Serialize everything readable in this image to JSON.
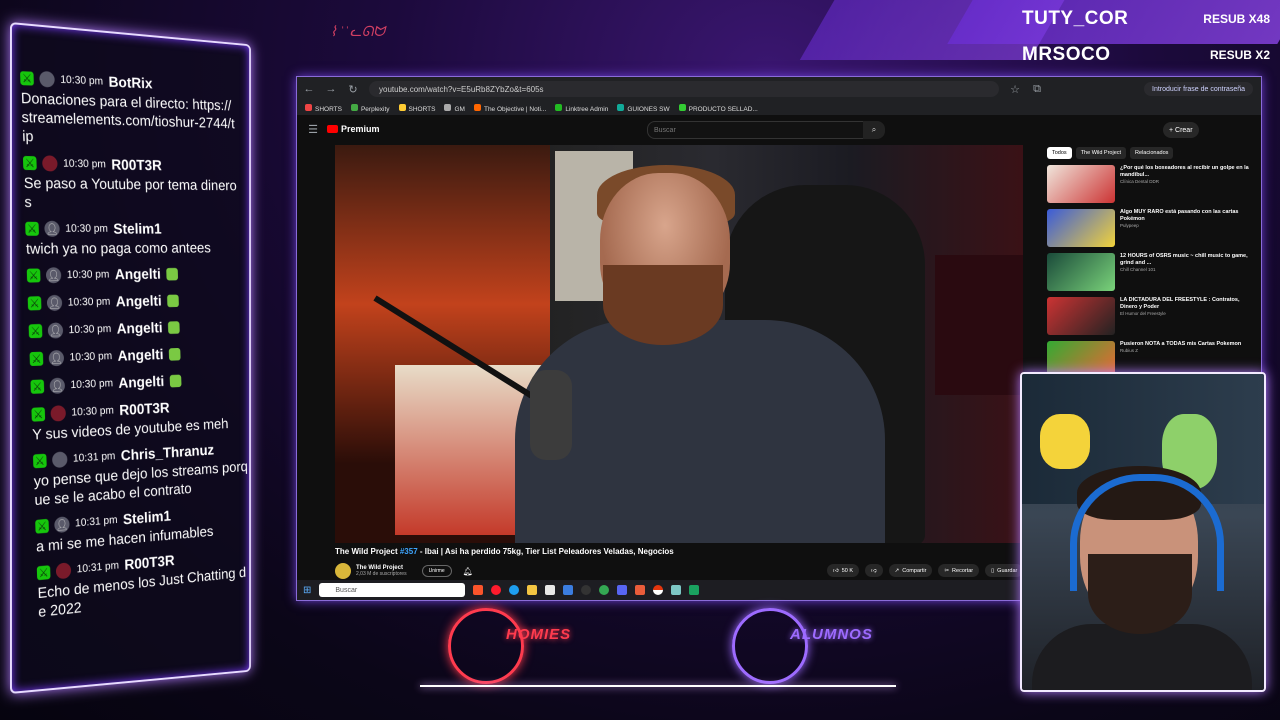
{
  "overlay": {
    "top_subs": [
      {
        "name": "TUTY_COR",
        "tag": "RESUB X48"
      },
      {
        "name": "MRSOCO",
        "tag": "RESUB X2"
      }
    ],
    "teams": [
      {
        "label": "HOMIES",
        "color": "#ff3b4e"
      },
      {
        "label": "ALUMNOS",
        "color": "#9d6bff"
      }
    ]
  },
  "chat": {
    "messages": [
      {
        "time": "10:30 pm",
        "user": "BotRix",
        "text": "Donaciones para el directo: https://streamelements.com/tioshur-2744/tip",
        "avatar": "bot"
      },
      {
        "time": "10:30 pm",
        "user": "R00T3R",
        "text": "Se paso a Youtube por tema dineros",
        "avatar": "red"
      },
      {
        "time": "10:30 pm",
        "user": "Stelim1",
        "text": "twich ya no paga como antees",
        "avatar": "default"
      },
      {
        "time": "10:30 pm",
        "user": "Angelti",
        "text": "",
        "avatar": "default",
        "emote": true
      },
      {
        "time": "10:30 pm",
        "user": "Angelti",
        "text": "",
        "avatar": "default",
        "emote": true
      },
      {
        "time": "10:30 pm",
        "user": "Angelti",
        "text": "",
        "avatar": "default",
        "emote": true
      },
      {
        "time": "10:30 pm",
        "user": "Angelti",
        "text": "",
        "avatar": "default",
        "emote": true
      },
      {
        "time": "10:30 pm",
        "user": "Angelti",
        "text": "",
        "avatar": "default",
        "emote": true
      },
      {
        "time": "10:30 pm",
        "user": "R00T3R",
        "text": "Y sus videos de youtube es meh",
        "avatar": "red"
      },
      {
        "time": "10:31 pm",
        "user": "Chris_Thranuz",
        "text": "yo pense que dejo los streams porque se le acabo el contrato",
        "avatar": "photo"
      },
      {
        "time": "10:31 pm",
        "user": "Stelim1",
        "text": "a mi se me hacen infumables",
        "avatar": "default"
      },
      {
        "time": "10:31 pm",
        "user": "R00T3R",
        "text": "Echo de menos los Just Chatting de 2022",
        "avatar": "red"
      }
    ]
  },
  "browser": {
    "url": "youtube.com/watch?v=E5uRb8ZYbZo&t=605s",
    "password_prompt": "Introducir frase de contraseña",
    "bookmarks": [
      "SHORTS",
      "Perplexity",
      "SHORTS",
      "GM",
      "The Objective | Noti...",
      "Linktree Admin",
      "GUIONES SW",
      "PRODUCTO SELLAD..."
    ],
    "youtube": {
      "logo_label": "Premium",
      "search_placeholder": "Buscar",
      "create_label": "+ Crear",
      "video_title_channel": "The Wild Project",
      "video_title_number": "#357",
      "video_title_rest": "- Ibai | Asi ha perdido 75kg, Tier List Peleadores Veladas, Negocios",
      "channel_name": "The Wild Project",
      "channel_subs": "2,03 M de suscriptores",
      "join_label": "Unirme",
      "likes": "50 K",
      "share_label": "Compartir",
      "clip_label": "Recortar",
      "save_label": "Guardar",
      "chips": [
        "Todos",
        "The Wild Project",
        "Relacionados"
      ],
      "recommendations": [
        {
          "title": "¿Por qué los boxeadores al recibir un golpe en la mandíbul...",
          "meta": "Clínica Dental DDR"
        },
        {
          "title": "Algo MUY RARO está pasando con las cartas Pokémon",
          "meta": "Pulypeep"
        },
        {
          "title": "12 HOURS of OSRS music ~ chill music to game, grind and ...",
          "meta": "Chill Channel 101"
        },
        {
          "title": "LA DICTADURA DEL FREESTYLE : Contratos, Dinero y Poder",
          "meta": "El Humor del Freestyle"
        },
        {
          "title": "Pusieron NOTA a TODAS mis Cartas Pokemon",
          "meta": "Rubius Z"
        }
      ]
    },
    "taskbar": {
      "search_placeholder": "Buscar"
    }
  },
  "colors": {
    "accent": "#9a4cff",
    "mod_badge": "#16c60c",
    "yt_red": "#ff0000"
  }
}
